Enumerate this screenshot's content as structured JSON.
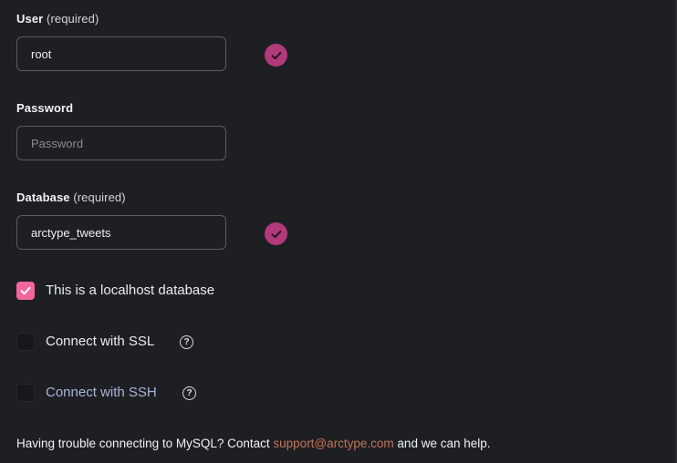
{
  "user": {
    "label": "User",
    "required": "(required)",
    "value": "root"
  },
  "password": {
    "label": "Password",
    "placeholder": "Password",
    "value": ""
  },
  "database": {
    "label": "Database",
    "required": "(required)",
    "value": "arctype_tweets"
  },
  "options": {
    "localhost": {
      "label": "This is a localhost database",
      "checked": true
    },
    "ssl": {
      "label": "Connect with SSL",
      "checked": false,
      "help": "?"
    },
    "ssh": {
      "label": "Connect with SSH",
      "checked": false,
      "help": "?"
    }
  },
  "footer": {
    "text_before": "Having trouble connecting to MySQL? Contact ",
    "link": "support@arctype.com",
    "text_after": " and we can help."
  },
  "colors": {
    "background": "#1e1f22",
    "valid_badge": "#b23a7a",
    "checkbox_checked": "#f2669e",
    "link": "#c2745a"
  },
  "icons": {
    "valid": "check-circle-icon",
    "checkbox_check": "check-icon",
    "help": "question-circle-icon"
  }
}
